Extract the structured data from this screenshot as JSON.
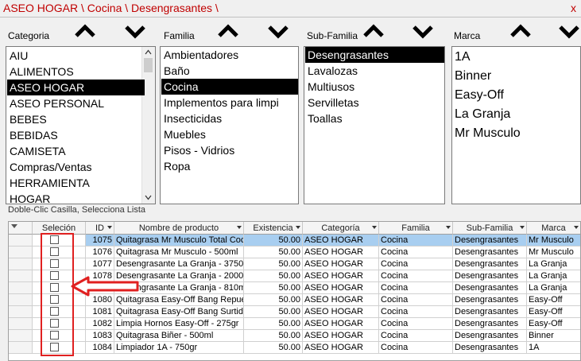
{
  "breadcrumb": "ASEO HOGAR \\ Cocina \\ Desengrasantes \\",
  "close_glyph": "x",
  "filters": {
    "categoria": {
      "label": "Categoria",
      "items": [
        "AIU",
        "ALIMENTOS",
        "ASEO HOGAR",
        "ASEO PERSONAL",
        "BEBES",
        "BEBIDAS",
        "CAMISETA",
        "Compras/Ventas",
        "HERRAMIENTA",
        "HOGAR"
      ],
      "selected": 2
    },
    "familia": {
      "label": "Familia",
      "items": [
        "Ambientadores",
        "Baño",
        "Cocina",
        "Implementos para limpi",
        "Insecticidas",
        "Muebles",
        "Pisos - Vidrios",
        "Ropa"
      ],
      "selected": 2
    },
    "subfamilia": {
      "label": "Sub-Familia",
      "items": [
        "Desengrasantes",
        "Lavalozas",
        "Multiusos",
        "Servilletas",
        "Toallas"
      ],
      "selected": 0
    },
    "marca": {
      "label": "Marca",
      "items": [
        "1A",
        "Binner",
        "Easy-Off",
        "La Granja",
        "Mr Musculo"
      ],
      "selected": -1
    }
  },
  "icons": {
    "up": "chevron-up-icon",
    "down": "chevron-down-icon",
    "scroll_up": "scroll-up-icon",
    "scroll_down": "scroll-down-icon"
  },
  "hint": "Doble-Clic Casilla, Selecciona Lista",
  "grid": {
    "columns": [
      "Seleción",
      "ID",
      "Nombre de producto",
      "Existencia",
      "Categoría",
      "Familia",
      "Sub-Familia",
      "Marca"
    ],
    "rows": [
      {
        "id": "1075",
        "name": "Quitagrasa Mr Musculo Total Coc",
        "stock": "50.00",
        "cat": "ASEO HOGAR",
        "fam": "Cocina",
        "sub": "Desengrasantes",
        "marca": "Mr Musculo",
        "selected": true
      },
      {
        "id": "1076",
        "name": "Quitagrasa Mr Musculo - 500ml",
        "stock": "50.00",
        "cat": "ASEO HOGAR",
        "fam": "Cocina",
        "sub": "Desengrasantes",
        "marca": "Mr Musculo",
        "selected": false
      },
      {
        "id": "1077",
        "name": "Desengrasante La Granja - 3750r",
        "stock": "50.00",
        "cat": "ASEO HOGAR",
        "fam": "Cocina",
        "sub": "Desengrasantes",
        "marca": "La Granja",
        "selected": false
      },
      {
        "id": "1078",
        "name": "Desengrasante La Granja - 2000r",
        "stock": "50.00",
        "cat": "ASEO HOGAR",
        "fam": "Cocina",
        "sub": "Desengrasantes",
        "marca": "La Granja",
        "selected": false
      },
      {
        "id": "1079",
        "name": "Desengrasante La Granja - 810m",
        "stock": "50.00",
        "cat": "ASEO HOGAR",
        "fam": "Cocina",
        "sub": "Desengrasantes",
        "marca": "La Granja",
        "selected": false
      },
      {
        "id": "1080",
        "name": "Quitagrasa Easy-Off Bang Repue",
        "stock": "50.00",
        "cat": "ASEO HOGAR",
        "fam": "Cocina",
        "sub": "Desengrasantes",
        "marca": "Easy-Off",
        "selected": false
      },
      {
        "id": "1081",
        "name": "Quitagrasa Easy-Off Bang Surtido",
        "stock": "50.00",
        "cat": "ASEO HOGAR",
        "fam": "Cocina",
        "sub": "Desengrasantes",
        "marca": "Easy-Off",
        "selected": false
      },
      {
        "id": "1082",
        "name": "Limpia Hornos Easy-Off - 275gr",
        "stock": "50.00",
        "cat": "ASEO HOGAR",
        "fam": "Cocina",
        "sub": "Desengrasantes",
        "marca": "Easy-Off",
        "selected": false
      },
      {
        "id": "1083",
        "name": "Quitagrasa Biñer - 500ml",
        "stock": "50.00",
        "cat": "ASEO HOGAR",
        "fam": "Cocina",
        "sub": "Desengrasantes",
        "marca": "Binner",
        "selected": false
      },
      {
        "id": "1084",
        "name": "Limpiador 1A - 750gr",
        "stock": "50.00",
        "cat": "ASEO HOGAR",
        "fam": "Cocina",
        "sub": "Desengrasantes",
        "marca": "1A",
        "selected": false
      }
    ]
  },
  "annotation": {
    "color": "#e02020"
  }
}
